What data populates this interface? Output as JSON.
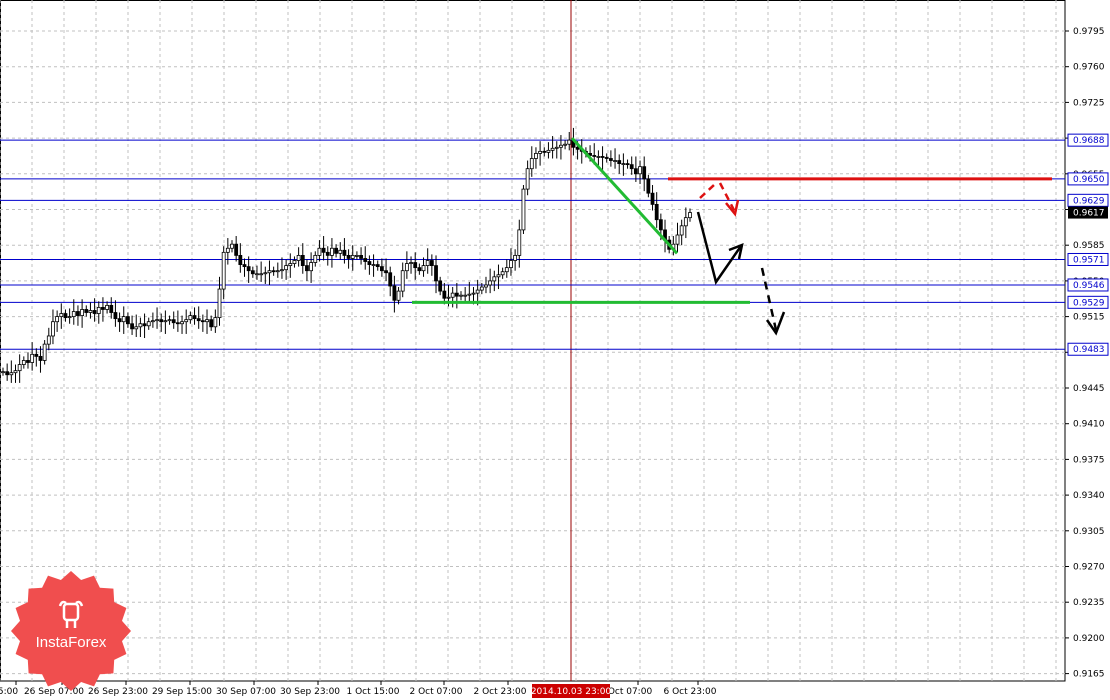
{
  "brand": {
    "name": "InstaForex",
    "color": "#f04e4e"
  },
  "chart_data": {
    "type": "candlestick",
    "y_axis": {
      "range": [
        0.915,
        0.9815
      ],
      "tick_labels": [
        "0.9795",
        "0.9760",
        "0.9725",
        "0.9690",
        "0.9655",
        "0.9620",
        "0.9585",
        "0.9550",
        "0.9515",
        "0.9480",
        "0.9445",
        "0.9410",
        "0.9375",
        "0.9340",
        "0.9305",
        "0.9270",
        "0.9235",
        "0.9200",
        "0.9165"
      ],
      "tick_values": [
        0.9795,
        0.976,
        0.9725,
        0.969,
        0.9655,
        0.962,
        0.9585,
        0.955,
        0.9515,
        0.948,
        0.9445,
        0.941,
        0.9375,
        0.934,
        0.9305,
        0.927,
        0.9235,
        0.92,
        0.9165
      ]
    },
    "x_axis": {
      "tick_labels": [
        "5:00",
        "26 Sep 07:00",
        "26 Sep 23:00",
        "29 Sep 15:00",
        "30 Sep 07:00",
        "30 Sep 23:00",
        "1 Oct 15:00",
        "2 Oct 07:00",
        "2 Oct 23:00",
        "Oct 07:00",
        "6 Oct 23:00"
      ],
      "cursor_label": "2014.10.03 23:00"
    },
    "grid": true,
    "current_price": {
      "value": 0.9617,
      "label": "0.9617"
    },
    "levels": [
      {
        "value": 0.9688,
        "label": "0.9688",
        "color": "#0000cc"
      },
      {
        "value": 0.965,
        "label": "0.9650",
        "color": "#0000cc"
      },
      {
        "value": 0.9629,
        "label": "0.9629",
        "color": "#0000cc"
      },
      {
        "value": 0.9571,
        "label": "0.9571",
        "color": "#0000cc"
      },
      {
        "value": 0.9546,
        "label": "0.9546",
        "color": "#0000cc"
      },
      {
        "value": 0.9529,
        "label": "0.9529",
        "color": "#0000cc"
      },
      {
        "value": 0.9483,
        "label": "0.9483",
        "color": "#0000cc"
      }
    ],
    "resistance_line": {
      "value": 0.965,
      "color": "#dd1111"
    },
    "support_line": {
      "value": 0.9529,
      "color": "#22bb33"
    },
    "trend_line": {
      "from": 0.969,
      "to": 0.9577,
      "color": "#22bb33"
    },
    "series": [
      {
        "values": [
          0.9461,
          0.9458,
          0.946,
          0.9462,
          0.9468,
          0.9472,
          0.947,
          0.9478,
          0.9476,
          0.9472,
          0.9488,
          0.9496,
          0.951,
          0.9515,
          0.9518,
          0.9514,
          0.9515,
          0.952,
          0.9516,
          0.9522,
          0.9519,
          0.9521,
          0.9518,
          0.9524,
          0.9522,
          0.9526,
          0.9519,
          0.9513,
          0.951,
          0.9515,
          0.9508,
          0.9503,
          0.9505,
          0.9508,
          0.9506,
          0.951,
          0.9511,
          0.9512,
          0.951,
          0.9511,
          0.9512,
          0.9509,
          0.9508,
          0.951,
          0.9512,
          0.9516,
          0.9513,
          0.9511,
          0.951,
          0.9512,
          0.9505,
          0.9514,
          0.9542,
          0.9578,
          0.9582,
          0.9586,
          0.9575,
          0.9566,
          0.9564,
          0.956,
          0.9557,
          0.9557,
          0.9557,
          0.9558,
          0.956,
          0.9559,
          0.956,
          0.9561,
          0.9565,
          0.9567,
          0.957,
          0.9575,
          0.9565,
          0.956,
          0.9568,
          0.9575,
          0.9582,
          0.9578,
          0.9575,
          0.9582,
          0.9577,
          0.958,
          0.9575,
          0.9572,
          0.9575,
          0.9575,
          0.9572,
          0.9569,
          0.9566,
          0.9566,
          0.9564,
          0.956,
          0.9558,
          0.9545,
          0.9531,
          0.954,
          0.956,
          0.9567,
          0.9568,
          0.9563,
          0.956,
          0.9565,
          0.957,
          0.9565,
          0.955,
          0.954,
          0.9533,
          0.9534,
          0.9538,
          0.9535,
          0.9536,
          0.9536,
          0.9537,
          0.9538,
          0.9541,
          0.9544,
          0.9546,
          0.955,
          0.9554,
          0.9556,
          0.9559,
          0.9563,
          0.957,
          0.9575,
          0.96,
          0.964,
          0.966,
          0.967,
          0.9675,
          0.9677,
          0.9676,
          0.9678,
          0.968,
          0.9681,
          0.9683,
          0.9684,
          0.9688,
          0.9681,
          0.9679,
          0.9677,
          0.9675,
          0.9673,
          0.9672,
          0.9672,
          0.9671,
          0.967,
          0.9668,
          0.9668,
          0.9665,
          0.9665,
          0.9664,
          0.966,
          0.9655,
          0.9662,
          0.965,
          0.9636,
          0.9625,
          0.961,
          0.96,
          0.959,
          0.9581,
          0.9586,
          0.9595,
          0.9604,
          0.9612,
          0.9617
        ]
      }
    ]
  }
}
